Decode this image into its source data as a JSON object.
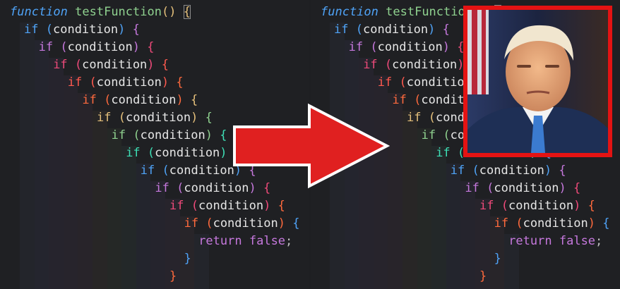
{
  "left": {
    "header": {
      "kw": "function",
      "name": "testFunction",
      "paren_open": "(",
      "paren_close": ")",
      "brace": "{"
    },
    "ret_kw": "return",
    "ret_val": "false",
    "ret_semi": ";"
  },
  "right": {
    "header": {
      "kw": "function",
      "name": "testFunction",
      "paren_open": "(",
      "paren_close": ")",
      "brace": "{"
    },
    "ret_kw": "return",
    "ret_val": "false",
    "ret_semi": ";"
  },
  "tokens": {
    "if": "if",
    "open": "(",
    "cond": "condition",
    "close": ")",
    "brace": "{",
    "close_brace": "}"
  },
  "colors": {
    "keyword_left": [
      "#4fa3f7",
      "#c678dd",
      "#ef4a7a",
      "#ff5a4f",
      "#ff6a3d",
      "#e5c07b",
      "#8fd18f",
      "#3ee0b6",
      "#4fa3f7",
      "#c678dd",
      "#ef4a7a",
      "#ff6a3d"
    ],
    "keyword_right": [
      "#4fa3f7",
      "#c678dd",
      "#ef4a7a",
      "#ff5a4f",
      "#ff6a3d",
      "#e5c07b",
      "#8fd18f",
      "#3ee0b6",
      "#4fa3f7",
      "#c678dd",
      "#ef4a7a",
      "#ff6a3d"
    ],
    "arrow": "#e02020",
    "frame": "#e41313"
  },
  "photo_label": "portrait-photo"
}
